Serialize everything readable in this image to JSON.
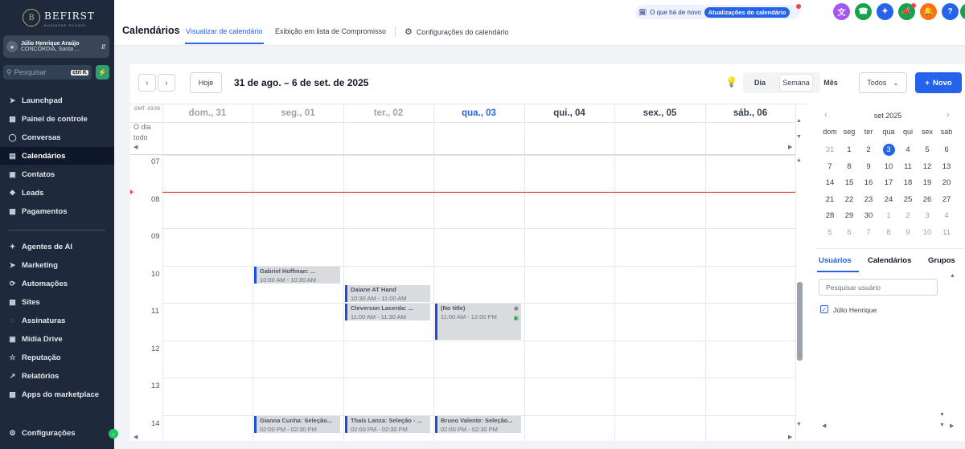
{
  "brand": {
    "name": "BEFIRST",
    "subtitle": "BUSINESS SCHOOL",
    "seal": "B"
  },
  "account": {
    "name": "Júlio Henrique Araújo",
    "location": "CONCÓRDIA, Santa ..."
  },
  "search": {
    "placeholder": "Pesquisar",
    "shortcut": "ctrl K"
  },
  "sidebar": {
    "items": [
      {
        "label": "Launchpad",
        "icon": "rocket-icon"
      },
      {
        "label": "Painel de controle",
        "icon": "dashboard-icon"
      },
      {
        "label": "Conversas",
        "icon": "chat-icon"
      },
      {
        "label": "Calendários",
        "icon": "calendar-icon",
        "active": true
      },
      {
        "label": "Contatos",
        "icon": "contacts-icon"
      },
      {
        "label": "Leads",
        "icon": "leads-icon"
      },
      {
        "label": "Pagamentos",
        "icon": "payments-icon"
      },
      {
        "label": "Agentes de AI",
        "icon": "sparkle-icon"
      },
      {
        "label": "Marketing",
        "icon": "send-icon"
      },
      {
        "label": "Automações",
        "icon": "automation-icon"
      },
      {
        "label": "Sites",
        "icon": "sites-icon"
      },
      {
        "label": "Assinaturas",
        "icon": "subscriptions-icon"
      },
      {
        "label": "Mídia Drive",
        "icon": "media-icon"
      },
      {
        "label": "Reputação",
        "icon": "star-icon"
      },
      {
        "label": "Relatórios",
        "icon": "chart-icon"
      },
      {
        "label": "Apps do marketplace",
        "icon": "apps-icon"
      }
    ],
    "settings": "Configurações"
  },
  "header": {
    "title": "Calendários",
    "tabs": [
      "Visualizar de calendário",
      "Exibição em lista de Compromisso",
      "Configurações do calendário"
    ],
    "news_label": "O que há de novo",
    "updates_label": "Atualizações do calendário"
  },
  "toolbar": {
    "today": "Hoje",
    "range": "31 de ago. – 6 de set. de 2025",
    "views": [
      "Dia",
      "Semana",
      "Mês"
    ],
    "filter": "Todos",
    "new": "Novo"
  },
  "calendar": {
    "gmt": "GMT -03:00",
    "all_day": "O dia todo",
    "days": [
      "dom., 31",
      "seg., 01",
      "ter., 02",
      "qua., 03",
      "qui., 04",
      "sex., 05",
      "sáb., 06"
    ],
    "today_index": 3,
    "hours": [
      "07",
      "08",
      "09",
      "10",
      "11",
      "12",
      "13",
      "14"
    ],
    "now_hour": 8.0,
    "events": [
      {
        "title": "Gabriel Hoffman: ...",
        "time": "10:00 AM - 10:30 AM",
        "day": 1,
        "start": 10.0,
        "end": 10.5
      },
      {
        "title": "Daiane AT Hand",
        "time": "10:30 AM - 11:00 AM",
        "day": 2,
        "start": 10.5,
        "end": 11.0
      },
      {
        "title": "Cleverson Lacerda: ...",
        "time": "11:00 AM - 11:30 AM",
        "day": 2,
        "start": 11.0,
        "end": 11.5
      },
      {
        "title": "(No title)",
        "time": "11:00 AM - 12:00 PM",
        "day": 3,
        "start": 11.0,
        "end": 12.0
      },
      {
        "title": "Gianna Cunha: Seleção...",
        "time": "02:00 PM - 02:30 PM",
        "day": 1,
        "start": 14.0,
        "end": 14.5
      },
      {
        "title": "Thaís Lanza: Seleção - ...",
        "time": "02:00 PM - 02:30 PM",
        "day": 2,
        "start": 14.0,
        "end": 14.5
      },
      {
        "title": "Bruno Valente: Seleção...",
        "time": "02:00 PM - 02:30 PM",
        "day": 3,
        "start": 14.0,
        "end": 14.5
      }
    ]
  },
  "mini_calendar": {
    "title": "set 2025",
    "weekdays": [
      "dom",
      "seg",
      "ter",
      "qua",
      "qui",
      "sex",
      "sab"
    ],
    "weeks": [
      [
        "31",
        "1",
        "2",
        "3",
        "4",
        "5",
        "6"
      ],
      [
        "7",
        "8",
        "9",
        "10",
        "11",
        "12",
        "13"
      ],
      [
        "14",
        "15",
        "16",
        "17",
        "18",
        "19",
        "20"
      ],
      [
        "21",
        "22",
        "23",
        "24",
        "25",
        "26",
        "27"
      ],
      [
        "28",
        "29",
        "30",
        "1",
        "2",
        "3",
        "4"
      ],
      [
        "5",
        "6",
        "7",
        "8",
        "9",
        "10",
        "11"
      ]
    ]
  },
  "right_panel": {
    "tabs": [
      "Usuários",
      "Calendários",
      "Grupos"
    ],
    "search_placeholder": "Pesquisar usuário",
    "users": [
      "Júlio Henrique"
    ]
  },
  "colors": {
    "accent": "#2563eb",
    "sidebar": "#1e2a3b",
    "now_line": "#ef4444"
  }
}
